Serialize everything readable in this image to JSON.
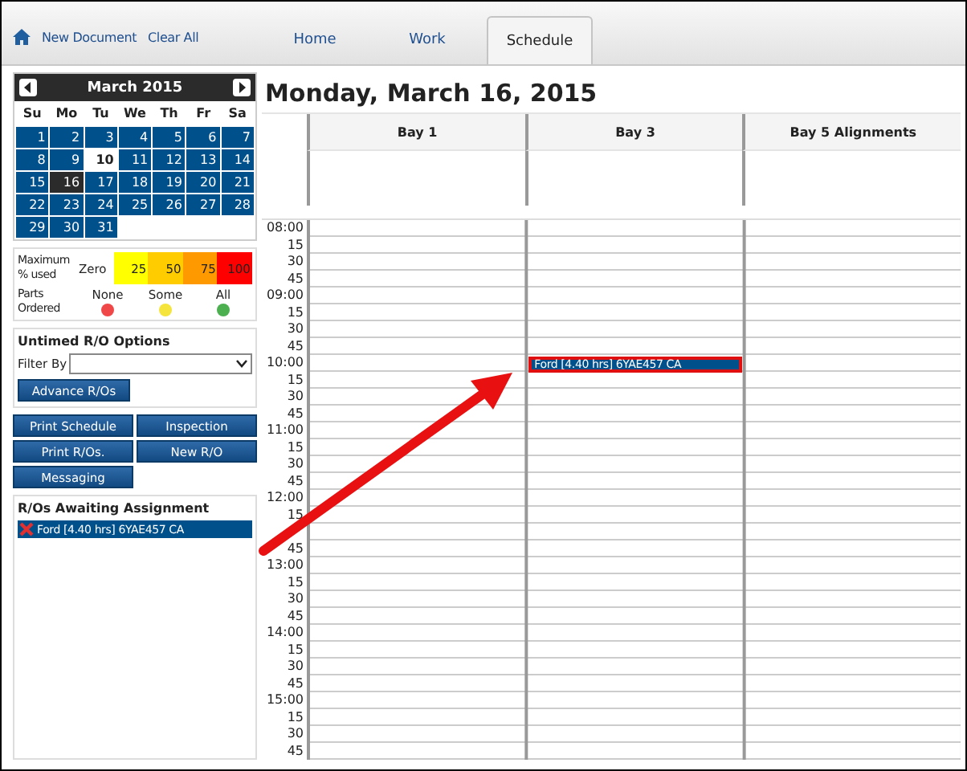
{
  "toolbar": {
    "links": [
      "New Document",
      "Clear All"
    ]
  },
  "tabs": [
    {
      "label": "Home",
      "selected": false
    },
    {
      "label": "Work",
      "selected": false
    },
    {
      "label": "Schedule",
      "selected": true
    }
  ],
  "calendar": {
    "title": "March 2015",
    "weekdays": [
      "Su",
      "Mo",
      "Tu",
      "We",
      "Th",
      "Fr",
      "Sa"
    ],
    "days": [
      {
        "day": "1",
        "available": true,
        "selected": false
      },
      {
        "day": "2",
        "available": true,
        "selected": false
      },
      {
        "day": "3",
        "available": true,
        "selected": false
      },
      {
        "day": "4",
        "available": true,
        "selected": false
      },
      {
        "day": "5",
        "available": true,
        "selected": false
      },
      {
        "day": "6",
        "available": true,
        "selected": false
      },
      {
        "day": "7",
        "available": true,
        "selected": false
      },
      {
        "day": "8",
        "available": true,
        "selected": false
      },
      {
        "day": "9",
        "available": true,
        "selected": false
      },
      {
        "day": "10",
        "available": false,
        "selected": false
      },
      {
        "day": "11",
        "available": true,
        "selected": false
      },
      {
        "day": "12",
        "available": true,
        "selected": false
      },
      {
        "day": "13",
        "available": true,
        "selected": false
      },
      {
        "day": "14",
        "available": true,
        "selected": false
      },
      {
        "day": "15",
        "available": true,
        "selected": false
      },
      {
        "day": "16",
        "available": true,
        "selected": true
      },
      {
        "day": "17",
        "available": true,
        "selected": false
      },
      {
        "day": "18",
        "available": true,
        "selected": false
      },
      {
        "day": "19",
        "available": true,
        "selected": false
      },
      {
        "day": "20",
        "available": true,
        "selected": false
      },
      {
        "day": "21",
        "available": true,
        "selected": false
      },
      {
        "day": "22",
        "available": true,
        "selected": false
      },
      {
        "day": "23",
        "available": true,
        "selected": false
      },
      {
        "day": "24",
        "available": true,
        "selected": false
      },
      {
        "day": "25",
        "available": true,
        "selected": false
      },
      {
        "day": "26",
        "available": true,
        "selected": false
      },
      {
        "day": "27",
        "available": true,
        "selected": false
      },
      {
        "day": "28",
        "available": true,
        "selected": false
      },
      {
        "day": "29",
        "available": true,
        "selected": false
      },
      {
        "day": "30",
        "available": true,
        "selected": false
      },
      {
        "day": "31",
        "available": true,
        "selected": false
      }
    ]
  },
  "legend": {
    "usage_label": "Maximum % used",
    "levels": [
      {
        "label": "Zero",
        "color": "#ffffff"
      },
      {
        "label": "25",
        "color": "#ffff00"
      },
      {
        "label": "50",
        "color": "#ffcc00"
      },
      {
        "label": "75",
        "color": "#ff9900"
      },
      {
        "label": "100",
        "color": "#ff0000"
      }
    ],
    "parts_label": "Parts Ordered",
    "parts": [
      {
        "label": "None",
        "color": "#f04848"
      },
      {
        "label": "Some",
        "color": "#f4e43c"
      },
      {
        "label": "All",
        "color": "#4caf50"
      }
    ]
  },
  "untimed": {
    "title": "Untimed R/O Options",
    "filter_label": "Filter By",
    "button": "Advance R/Os"
  },
  "actions": [
    "Print Schedule",
    "Inspection",
    "Print R/Os.",
    "New R/O",
    "Messaging"
  ],
  "awaiting": {
    "title": "R/Os Awaiting Assignment",
    "items": [
      {
        "label": "Ford [4.40 hrs] 6YAE457 CA",
        "selected": true
      }
    ]
  },
  "schedule": {
    "date": "Monday, March 16, 2015",
    "bays": [
      "Bay 1",
      "Bay 3",
      "Bay 5 Alignments"
    ],
    "rows": [
      {
        "time": "08:00"
      },
      {
        "time": "15"
      },
      {
        "time": "30"
      },
      {
        "time": "45"
      },
      {
        "time": "09:00"
      },
      {
        "time": "15"
      },
      {
        "time": "30"
      },
      {
        "time": "45"
      },
      {
        "time": "10:00",
        "cells": [
          {
            "booked": false
          },
          {
            "booked": true,
            "label": "Ford [4.40 hrs] 6YAE457 CA",
            "selected": true
          },
          {
            "booked": false
          }
        ]
      },
      {
        "time": "15"
      },
      {
        "time": "30"
      },
      {
        "time": "45"
      },
      {
        "time": "11:00"
      },
      {
        "time": "15"
      },
      {
        "time": "30"
      },
      {
        "time": "45"
      },
      {
        "time": "12:00"
      },
      {
        "time": "15"
      },
      {},
      {
        "time": "45"
      },
      {
        "time": "13:00"
      },
      {
        "time": "15"
      },
      {
        "time": "30"
      },
      {
        "time": "45"
      },
      {
        "time": "14:00"
      },
      {
        "time": "15"
      },
      {
        "time": "30"
      },
      {
        "time": "45"
      },
      {
        "time": "15:00"
      },
      {
        "time": "15"
      },
      {
        "time": "30"
      },
      {
        "time": "45"
      }
    ]
  }
}
